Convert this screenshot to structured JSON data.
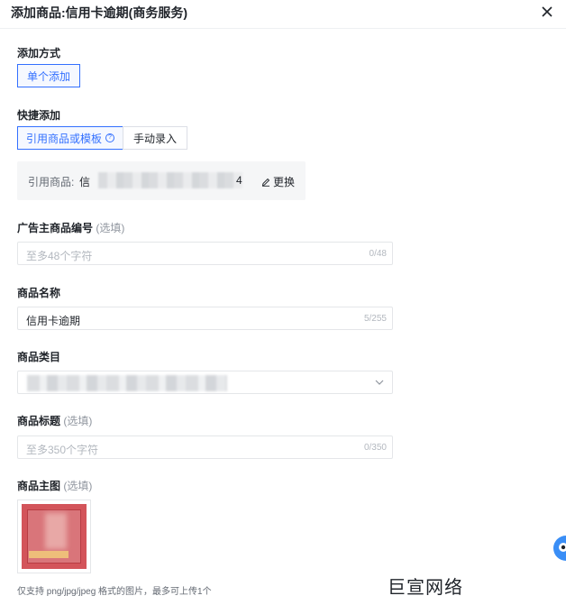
{
  "header": {
    "title": "添加商品:信用卡逾期(商务服务)"
  },
  "add_method": {
    "label": "添加方式",
    "options": [
      "单个添加"
    ],
    "selected": "单个添加"
  },
  "quick_add": {
    "label": "快捷添加",
    "options": [
      "引用商品或模板",
      "手动录入"
    ],
    "selected": "引用商品或模板"
  },
  "reference": {
    "label": "引用商品:",
    "value_prefix": "信",
    "value_suffix": "4",
    "change_label": "更换"
  },
  "advertiser_code": {
    "label": "广告主商品编号",
    "optional": "(选填)",
    "placeholder": "至多48个字符",
    "counter": "0/48"
  },
  "product_name": {
    "label": "商品名称",
    "value": "信用卡逾期",
    "counter": "5/255"
  },
  "category": {
    "label": "商品类目"
  },
  "product_title": {
    "label": "商品标题",
    "optional": "(选填)",
    "placeholder": "至多350个字符",
    "counter": "0/350"
  },
  "main_image": {
    "label": "商品主图",
    "optional": "(选填)",
    "hint": "仅支持 png/jpg/jpeg 格式的图片，最多可上传1个"
  },
  "watermark": "巨宣网络",
  "colors": {
    "accent": "#3370ff",
    "text": "#1f2329",
    "muted": "#8f959e"
  }
}
